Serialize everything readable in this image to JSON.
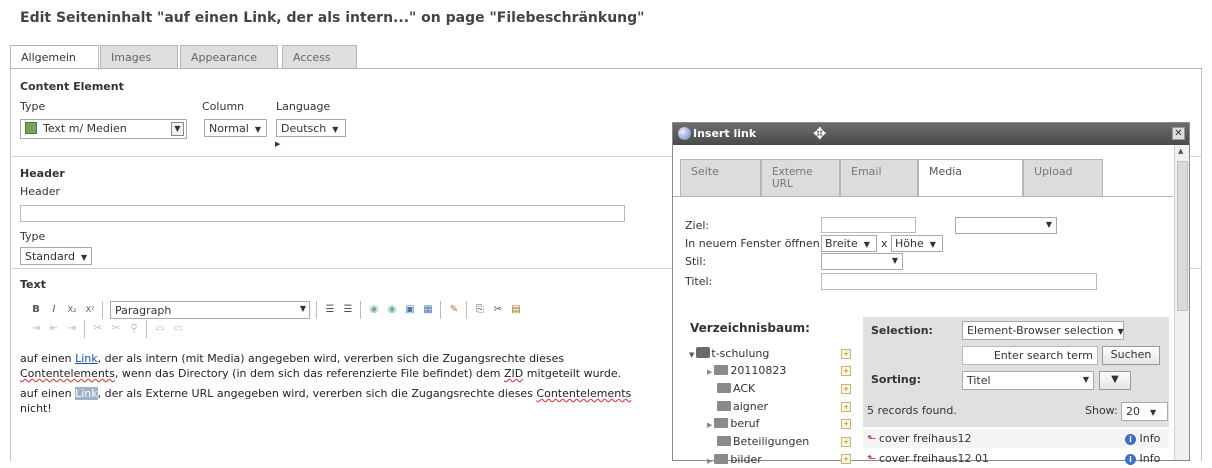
{
  "page_title": "Edit Seiteninhalt \"auf einen Link, der als intern...\" on page \"Filebeschränkung\"",
  "tabs": [
    "Allgemein",
    "Images",
    "Appearance",
    "Access"
  ],
  "content_element": {
    "heading": "Content Element",
    "type_label": "Type",
    "type_value": "Text m/ Medien",
    "column_label": "Column",
    "column_value": "Normal",
    "language_label": "Language",
    "language_value": "Deutsch"
  },
  "header_section": {
    "heading": "Header",
    "header_label": "Header",
    "header_value": "",
    "type_label": "Type",
    "type_value": "Standard"
  },
  "text_section": {
    "heading": "Text",
    "format_value": "Paragraph",
    "para1_a": "auf einen ",
    "para1_link": "Link",
    "para1_b": ", der als intern (mit Media) angegeben wird, vererben sich die Zugangsrechte dieses",
    "para1_c": "Contentelements",
    "para1_d": ", wenn das Directory (in dem sich das referenzierte File befindet) dem ",
    "para1_e": "ZID",
    "para1_f": " mitgeteilt wurde.",
    "para2_a": "auf einen ",
    "para2_link": "Link",
    "para2_b": ", der als Externe URL angegeben wird, vererben sich die Zugangsrechte dieses ",
    "para2_c": "Contentelements",
    "para2_d": "nicht!"
  },
  "dialog": {
    "title": "Insert link",
    "tabs": [
      {
        "label": "Seite"
      },
      {
        "label": "Externe URL"
      },
      {
        "label": "Email"
      },
      {
        "label": "Media"
      },
      {
        "label": "Upload"
      }
    ],
    "ziel_label": "Ziel:",
    "neues_fenster_label": "In neuem Fenster öffnen:",
    "breite_value": "Breite",
    "x_label": "x",
    "hoehe_value": "Höhe",
    "stil_label": "Stil:",
    "titel_label": "Titel:",
    "tree_heading": "Verzeichnisbaum:",
    "tree": [
      "t-schulung",
      "20110823",
      "ACK",
      "aigner",
      "beruf",
      "Beteiligungen",
      "bilder"
    ],
    "selection_label": "Selection:",
    "selection_value": "Element-Browser selection",
    "search_placeholder": "Enter search term",
    "search_button": "Suchen",
    "sorting_label": "Sorting:",
    "sorting_value": "Titel",
    "records_found": "5 records found.",
    "show_label": "Show:",
    "show_value": "20",
    "records": [
      {
        "name": "cover freihaus12",
        "info": "Info"
      },
      {
        "name": "cover freihaus12 01",
        "info": "Info"
      }
    ]
  }
}
